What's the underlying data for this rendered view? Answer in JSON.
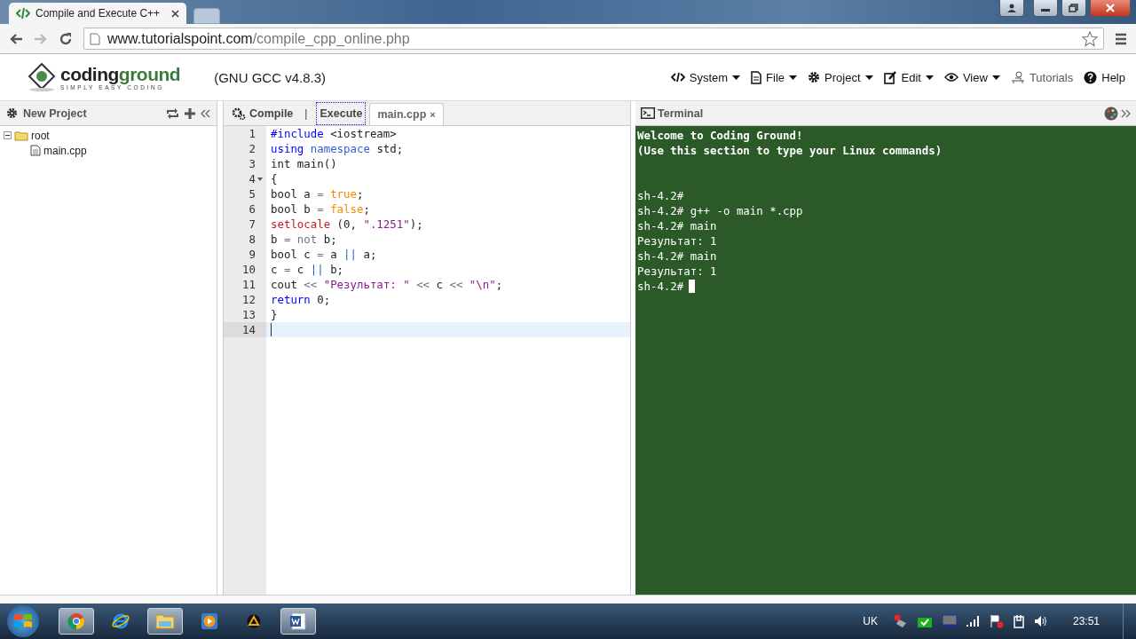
{
  "browser": {
    "tab_title": "Compile and Execute C++",
    "url_host": "www.tutorialspoint.com",
    "url_path": "/compile_cpp_online.php"
  },
  "header": {
    "logo_word_a": "coding",
    "logo_word_b": "ground",
    "logo_tagline": "SIMPLY EASY CODING",
    "compiler": "(GNU GCC v4.8.3)",
    "menu": [
      {
        "label": "System",
        "kind": "code",
        "dropdown": true
      },
      {
        "label": "File",
        "kind": "file",
        "dropdown": true
      },
      {
        "label": "Project",
        "kind": "gear",
        "dropdown": true
      },
      {
        "label": "Edit",
        "kind": "edit",
        "dropdown": true
      },
      {
        "label": "View",
        "kind": "eye",
        "dropdown": true
      },
      {
        "label": "Tutorials",
        "kind": "tutorials",
        "dropdown": false
      },
      {
        "label": "Help",
        "kind": "help",
        "dropdown": false
      }
    ]
  },
  "sidebar": {
    "title": "New Project",
    "tree": [
      {
        "label": "root",
        "kind": "folder",
        "expanded": true,
        "children": [
          {
            "label": "main.cpp",
            "kind": "file"
          }
        ]
      }
    ]
  },
  "editor": {
    "compile": "Compile",
    "separator": "|",
    "execute": "Execute",
    "tabs": [
      {
        "label": "main.cpp",
        "selected": true,
        "close": "×"
      }
    ],
    "lines": [
      {
        "n": "1",
        "fold": false,
        "current": false,
        "tokens": [
          {
            "text": "#include",
            "kind": "keyword"
          },
          {
            "text": " <iostream>",
            "kind": "plain"
          }
        ]
      },
      {
        "n": "2",
        "fold": false,
        "current": false,
        "tokens": [
          {
            "text": "using",
            "kind": "keyword"
          },
          {
            "text": " namespace",
            "kind": "storage"
          },
          {
            "text": " std;",
            "kind": "plain"
          }
        ]
      },
      {
        "n": "3",
        "fold": false,
        "current": false,
        "tokens": [
          {
            "text": "int main()",
            "kind": "plain"
          }
        ]
      },
      {
        "n": "4",
        "fold": true,
        "current": false,
        "tokens": [
          {
            "text": "{",
            "kind": "plain"
          }
        ]
      },
      {
        "n": "5",
        "fold": false,
        "current": false,
        "tokens": [
          {
            "text": "bool a ",
            "kind": "plain"
          },
          {
            "text": "=",
            "kind": "operator"
          },
          {
            "text": " true",
            "kind": "constant"
          },
          {
            "text": ";",
            "kind": "plain"
          }
        ]
      },
      {
        "n": "6",
        "fold": false,
        "current": false,
        "tokens": [
          {
            "text": "bool b ",
            "kind": "plain"
          },
          {
            "text": "=",
            "kind": "operator"
          },
          {
            "text": " false",
            "kind": "constant"
          },
          {
            "text": ";",
            "kind": "plain"
          }
        ]
      },
      {
        "n": "7",
        "fold": false,
        "current": false,
        "tokens": [
          {
            "text": "setlocale",
            "kind": "function"
          },
          {
            "text": " (0, ",
            "kind": "plain"
          },
          {
            "text": "\".1251\"",
            "kind": "string"
          },
          {
            "text": ");",
            "kind": "plain"
          }
        ]
      },
      {
        "n": "8",
        "fold": false,
        "current": false,
        "tokens": [
          {
            "text": "b ",
            "kind": "plain"
          },
          {
            "text": "= not",
            "kind": "operator"
          },
          {
            "text": " b;",
            "kind": "plain"
          }
        ]
      },
      {
        "n": "9",
        "fold": false,
        "current": false,
        "tokens": [
          {
            "text": "bool c ",
            "kind": "plain"
          },
          {
            "text": "=",
            "kind": "operator"
          },
          {
            "text": " a ",
            "kind": "plain"
          },
          {
            "text": "||",
            "kind": "storage"
          },
          {
            "text": " a;",
            "kind": "plain"
          }
        ]
      },
      {
        "n": "10",
        "fold": false,
        "current": false,
        "tokens": [
          {
            "text": "c ",
            "kind": "plain"
          },
          {
            "text": "=",
            "kind": "operator"
          },
          {
            "text": " c ",
            "kind": "plain"
          },
          {
            "text": "||",
            "kind": "storage"
          },
          {
            "text": " b;",
            "kind": "plain"
          }
        ]
      },
      {
        "n": "11",
        "fold": false,
        "current": false,
        "tokens": [
          {
            "text": "cout ",
            "kind": "plain"
          },
          {
            "text": "<<",
            "kind": "operator"
          },
          {
            "text": " \"Результат: \"",
            "kind": "string"
          },
          {
            "text": " <<",
            "kind": "operator"
          },
          {
            "text": " c ",
            "kind": "plain"
          },
          {
            "text": "<<",
            "kind": "operator"
          },
          {
            "text": " \"\\n\"",
            "kind": "string"
          },
          {
            "text": ";",
            "kind": "plain"
          }
        ]
      },
      {
        "n": "12",
        "fold": false,
        "current": false,
        "tokens": [
          {
            "text": "return",
            "kind": "keyword"
          },
          {
            "text": " 0;",
            "kind": "plain"
          }
        ]
      },
      {
        "n": "13",
        "fold": false,
        "current": false,
        "tokens": [
          {
            "text": "}",
            "kind": "plain"
          }
        ]
      },
      {
        "n": "14",
        "fold": false,
        "current": true
      }
    ]
  },
  "terminal": {
    "title": "Terminal",
    "welcome": [
      "Welcome to Coding Ground!",
      "(Use this section to type your Linux commands)"
    ],
    "output": [
      "sh-4.2#",
      "sh-4.2# g++ -o main *.cpp",
      "sh-4.2# main",
      "Результат: 1",
      "sh-4.2# main",
      "Результат: 1",
      "sh-4.2#"
    ],
    "cursor": true
  },
  "taskbar": {
    "apps": [
      {
        "kind": "chrome",
        "selected": true
      },
      {
        "kind": "ie",
        "selected": false
      },
      {
        "kind": "folder",
        "selected": true
      },
      {
        "kind": "player",
        "selected": false
      },
      {
        "kind": "aimp",
        "selected": false
      },
      {
        "kind": "word",
        "selected": true
      }
    ],
    "language": "UK",
    "clock": "23:51"
  }
}
